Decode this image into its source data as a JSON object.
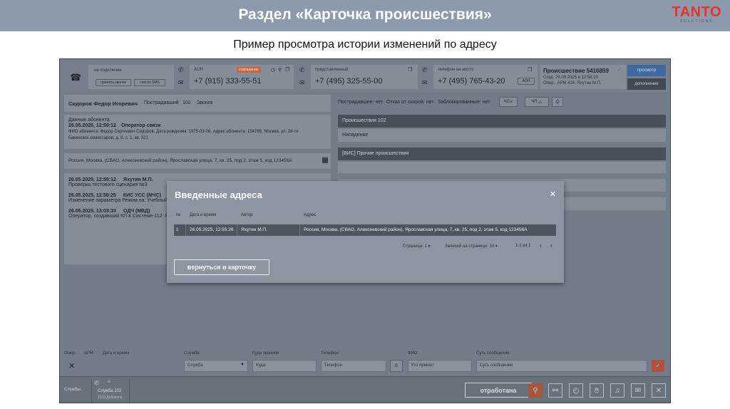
{
  "slide": {
    "title": "Раздел «Карточка происшествия»",
    "subtitle": "Пример просмотра истории изменений по адресу",
    "logo": "TANTO",
    "logo_sub": "SOLUTIONS"
  },
  "app": {
    "call1": {
      "status": "не подключен",
      "btn1": "принять звонок",
      "btn2": "список SMS"
    },
    "aon": {
      "label": "АОН",
      "badge": "совпадение",
      "phone": "+7 (915) 333-55-51"
    },
    "representative": {
      "label": "представленный",
      "phone": "+7 (495) 325-55-00"
    },
    "onsite": {
      "label": "телефон на место",
      "phone": "+7 (495) 765-43-20",
      "btn": "АОН"
    },
    "incident": {
      "title": "Происшествие 5416859",
      "line1": "Созд. 26.05.2025 в 12:58:10",
      "line2": "Опер., АРМ 426, Яхутин М.П.",
      "view_btn": "просмотр",
      "more_btn": "дополнение"
    },
    "person": {
      "name": "Сидоров Федор Игоревич",
      "role": "Пострадавший",
      "code": "102",
      "call": "Звонок"
    },
    "subscriber": {
      "header": "Данные абонента",
      "date": "26.05.2025, 12:59:12",
      "op": "Оператор связи",
      "text1": "ФИО абонента: Федор Сергеевич Сидоров, Дата рождения: 1975-03-06, Адрес абонента: 154789, Москва, ул. 26-ти",
      "text2": "Бакинских комиссаров, д. 6, с. 1, кв. 321"
    },
    "address_line": "Россия, Москва, (СВАО, Алексеевский район), Ярославская улица, 7, кв. 25, под 2, этаж 5, код 123456А",
    "history": [
      {
        "date": "26.05.2025, 12:59:12",
        "who": "Яхутин М.П.",
        "text": "Проверка тестового сценария №3"
      },
      {
        "date": "26.05.2025, 12:59:25",
        "who": "КИС УСС (МЧС)",
        "text": "Изменение параметра Режим на: Учебный"
      },
      {
        "date": "26.05.2025, 13:03:33",
        "who": "ОДЧ (МВД)",
        "text": "Оператор, создавший КП в Системе-112: Як"
      }
    ],
    "flags": {
      "victims": "Пострадавшие: нет",
      "refuse": "Отказ от скорой: нет",
      "blocked": "Заблокированные: нет",
      "chs": "ЧС",
      "chp": "ЧП"
    },
    "right_panels": {
      "p1": "Происшествия 102",
      "p1_item": "Нападение",
      "p2": "[ВИС] Прочие происшествия"
    },
    "form": {
      "h_pos": "Опер.",
      "h_arm": "АРМ",
      "h_date": "Дата и время",
      "h_service": "Служба",
      "h_where": "Куда звонили",
      "h_phone": "Телефон",
      "h_fio": "ФИО",
      "h_msg": "Суть сообщения",
      "service_ph": "Служба",
      "where_ph": "Куда",
      "phone_ph": "Телефон",
      "fio_ph": "Кто принял",
      "msg_ph": "Суть сообщения"
    },
    "bottom": {
      "services_label": "Службы:",
      "service": "Служба 102",
      "service_sub": "1103 Добавочн",
      "done_btn": "отработана"
    }
  },
  "modal": {
    "title": "Введенные адреса",
    "columns": [
      "№",
      "Дата и время",
      "Автор",
      "Адрес"
    ],
    "rows": [
      {
        "n": "1",
        "date": "26.05.2025, 12:55:26",
        "author": "Яхутин М.П.",
        "address": "Россия, Москва, (СВАО, Алексеевский район), Ярославская улица, 7, кв. 25, под 2, этаж 5, код 123456А"
      }
    ],
    "pager": {
      "page": "Страница: 1",
      "per_page": "Записей на странице: 10",
      "range": "1-1 из 1"
    },
    "back_btn": "вернуться в карточку"
  },
  "icons": [
    "close-icon",
    "chevron-left-icon",
    "chevron-right-icon",
    "dropdown-arrow-icon",
    "phone-icon",
    "message-icon",
    "pin-icon",
    "clock-icon",
    "hand-icon",
    "bell-icon",
    "print-icon",
    "warning-icon",
    "fire-icon",
    "link-icon"
  ]
}
